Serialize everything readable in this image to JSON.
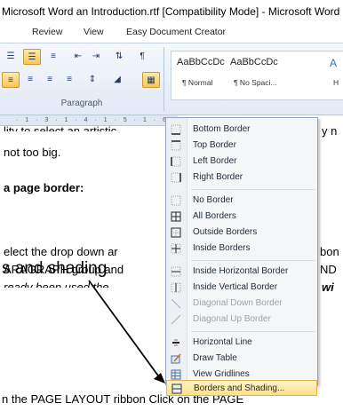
{
  "window": {
    "title": "Microsoft Word an Introduction.rtf [Compatibility Mode]  -  Microsoft Word"
  },
  "ribbon": {
    "tabs": [
      "Review",
      "View",
      "Easy Document Creator"
    ],
    "group_label": "Paragraph",
    "styles": [
      {
        "sample": "AaBbCcDc",
        "name": "¶ Normal"
      },
      {
        "sample": "AaBbCcDc",
        "name": "¶ No Spaci..."
      },
      {
        "sample": "A",
        "name": "H"
      }
    ]
  },
  "ruler": {
    "text": "· 1 · 3 · 1 · 4 · 1 · 5 · 1 · 6 ·"
  },
  "document": {
    "line1": "lity to select an artistic",
    "line1_right": "y n",
    "line2": "not too big.",
    "heading": "a page border:",
    "line4": "elect the drop down ar",
    "line4_right": "bon",
    "line5": "ARAGRAPH group and",
    "line5_right": "ND",
    "line6": "ready been used the",
    "line6_right": "wi",
    "bottom": "n the PAGE LAYOUT ribbon Click on the PAGE"
  },
  "annotation": {
    "text": "s and shading"
  },
  "borders_menu": {
    "items": [
      {
        "label": "Bottom Border",
        "icon": "bottom-border-icon"
      },
      {
        "label": "Top Border",
        "icon": "top-border-icon"
      },
      {
        "label": "Left Border",
        "icon": "left-border-icon"
      },
      {
        "label": "Right Border",
        "icon": "right-border-icon"
      },
      {
        "label": "No Border",
        "icon": "no-border-icon"
      },
      {
        "label": "All Borders",
        "icon": "all-borders-icon"
      },
      {
        "label": "Outside Borders",
        "icon": "outside-borders-icon"
      },
      {
        "label": "Inside Borders",
        "icon": "inside-borders-icon"
      },
      {
        "label": "Inside Horizontal Border",
        "icon": "inside-horizontal-border-icon"
      },
      {
        "label": "Inside Vertical Border",
        "icon": "inside-vertical-border-icon"
      },
      {
        "label": "Diagonal Down Border",
        "icon": "diagonal-down-border-icon",
        "disabled": true
      },
      {
        "label": "Diagonal Up Border",
        "icon": "diagonal-up-border-icon",
        "disabled": true
      },
      {
        "label": "Horizontal Line",
        "icon": "horizontal-line-icon"
      },
      {
        "label": "Draw Table",
        "icon": "draw-table-icon"
      },
      {
        "label": "View Gridlines",
        "icon": "view-gridlines-icon"
      },
      {
        "label": "Borders and Shading...",
        "icon": "borders-and-shading-icon",
        "highlighted": true
      }
    ]
  }
}
